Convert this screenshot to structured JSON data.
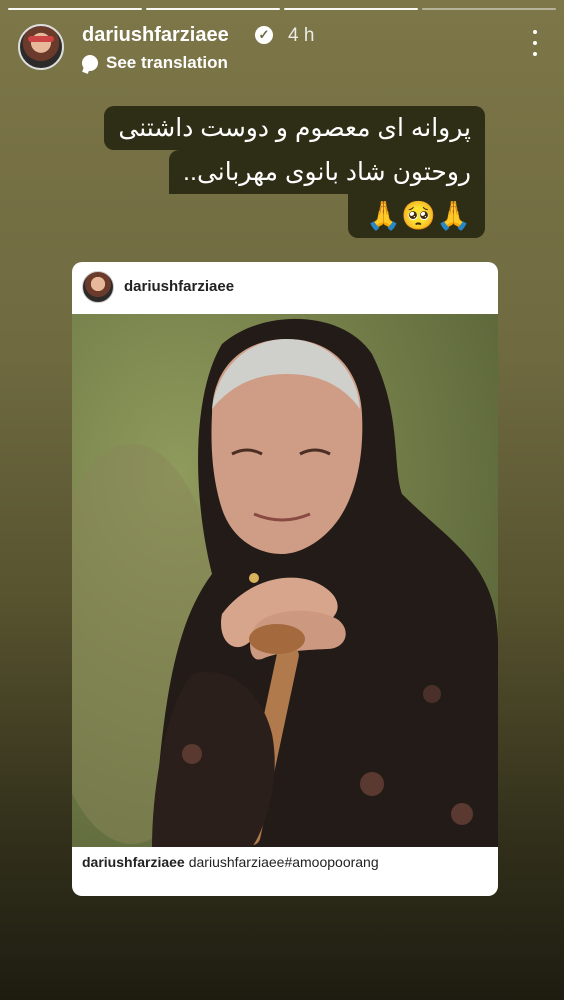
{
  "progress": {
    "total_segments": 4,
    "completed_segments": 3
  },
  "header": {
    "username": "dariushfarziaee",
    "verified_icon": "verified-badge-icon",
    "time": "4 h",
    "menu_icon": "more-vertical-icon",
    "translate_label": "See translation",
    "translate_icon": "speech-bubble-icon"
  },
  "caption": {
    "line1": "پروانه ای معصوم و دوست داشتنی",
    "line2": "روحتون شاد بانوی مهربانی..",
    "emoji": "🙏🥺🙏"
  },
  "shared_post": {
    "username": "dariushfarziaee",
    "footer_user": "dariushfarziaee",
    "footer_text": "dariushfarziaee#amoopoorang",
    "photo_subject": "elderly woman in black headscarf leaning on a wooden cane"
  },
  "colors": {
    "caption_background": "#2e2d15",
    "background_top": "#7c7648",
    "background_bottom": "#1d1c10"
  }
}
